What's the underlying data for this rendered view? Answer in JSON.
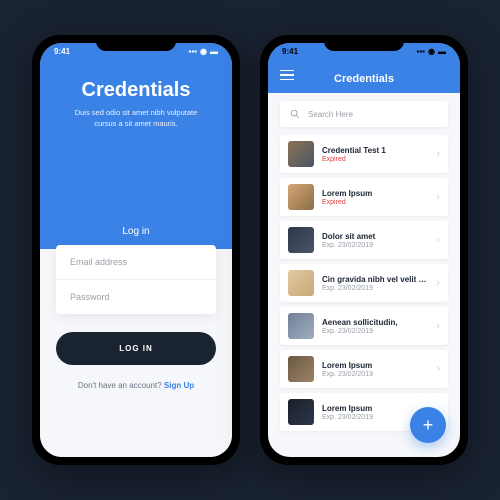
{
  "status": {
    "time": "9:41"
  },
  "login": {
    "title": "Credentials",
    "subtitle": "Duis sed odio sit amet nibh vulputate cursus a sit amet mauris.",
    "tab_label": "Log in",
    "email_placeholder": "Email address",
    "password_placeholder": "Password",
    "button_label": "LOG IN",
    "signup_prompt": "Don't have an account? ",
    "signup_link": "Sign Up"
  },
  "list": {
    "header_title": "Credentials",
    "search_placeholder": "Search Here",
    "items": [
      {
        "title": "Credential Test 1",
        "sub": "Expired",
        "status": "expired"
      },
      {
        "title": "Lorem Ipsum",
        "sub": "Expired",
        "status": "expired"
      },
      {
        "title": "Dolor sit amet",
        "sub": "Exp. 23/02/2019",
        "status": "normal"
      },
      {
        "title": "Cin gravida nibh vel velit auctor",
        "sub": "Exp. 23/02/2019",
        "status": "normal"
      },
      {
        "title": "Aenean sollicitudin,",
        "sub": "Exp. 23/02/2019",
        "status": "normal"
      },
      {
        "title": "Lorem Ipsum",
        "sub": "Exp. 23/02/2019",
        "status": "normal"
      },
      {
        "title": "Lorem Ipsum",
        "sub": "Exp. 23/02/2019",
        "status": "normal"
      }
    ],
    "fab_label": "+"
  }
}
